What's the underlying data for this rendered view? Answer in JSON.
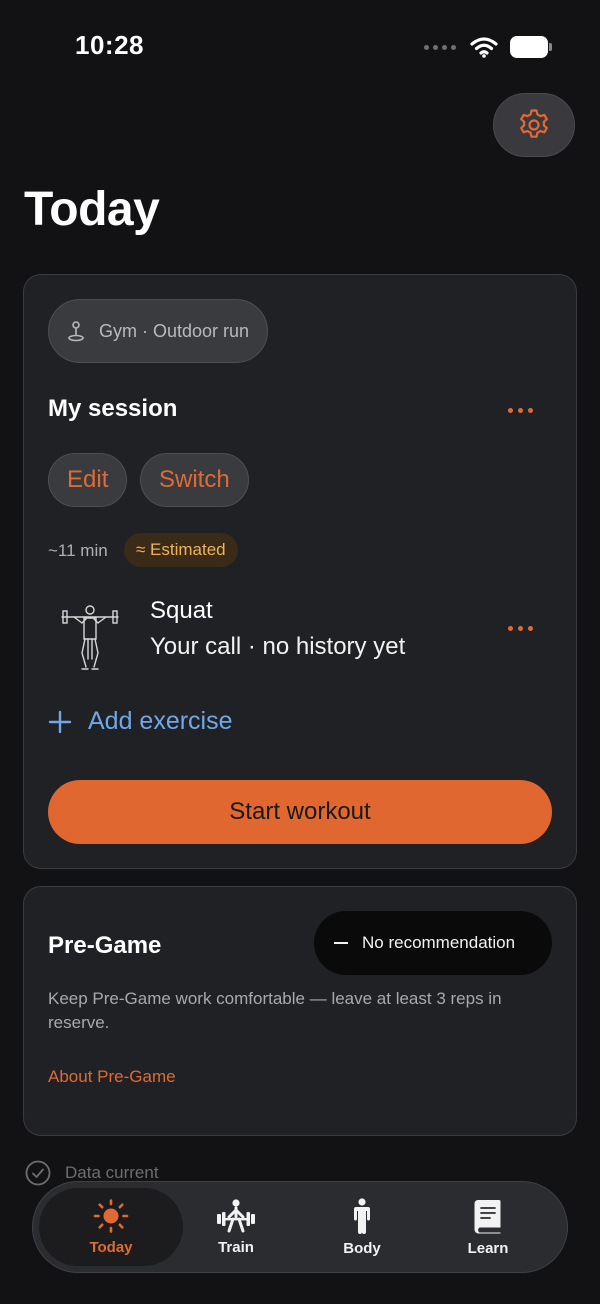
{
  "status_bar": {
    "time": "10:28"
  },
  "page": {
    "title": "Today"
  },
  "session": {
    "location": "Gym · Outdoor run",
    "title": "My session",
    "edit_label": "Edit",
    "switch_label": "Switch",
    "duration": "~11 min",
    "estimated_label": "≈ Estimated",
    "exercise": {
      "name": "Squat",
      "detail": "Your call · no history yet"
    },
    "add_exercise_label": "Add exercise",
    "start_label": "Start workout"
  },
  "pregame": {
    "title": "Pre-Game",
    "recommendation": "No recommendation",
    "body": "Keep Pre-Game work comfortable — leave at least 3 reps in reserve.",
    "link": "About Pre-Game"
  },
  "data_status": "Data current",
  "tabs": [
    {
      "label": "Today",
      "icon": "sun-icon",
      "active": true
    },
    {
      "label": "Train",
      "icon": "barbell-lifter-icon",
      "active": false
    },
    {
      "label": "Body",
      "icon": "person-icon",
      "active": false
    },
    {
      "label": "Learn",
      "icon": "book-icon",
      "active": false
    }
  ],
  "colors": {
    "accent": "#e06a35",
    "link": "#6fa8e8",
    "estimated": "#f0b25a",
    "background": "#121214",
    "card": "#1f2124"
  }
}
